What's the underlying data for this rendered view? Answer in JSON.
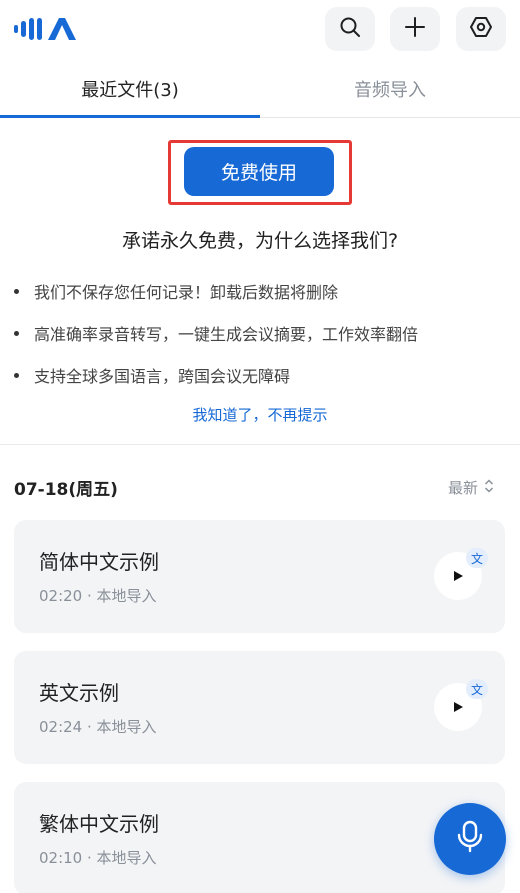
{
  "app": {
    "logo_icon": "mia-logo-icon",
    "accent": "#1769d6"
  },
  "header": {
    "buttons": [
      {
        "icon": "search-icon"
      },
      {
        "icon": "plus-icon"
      },
      {
        "icon": "settings-hex-icon"
      }
    ]
  },
  "tabs": [
    {
      "label": "最近文件(3)",
      "active": true
    },
    {
      "label": "音频导入",
      "active": false
    }
  ],
  "promo": {
    "button_label": "免费使用",
    "title": "承诺永久免费，为什么选择我们?",
    "bullets": [
      "我们不保存您任何记录！卸载后数据将删除",
      "高准确率录音转写，一键生成会议摘要，工作效率翻倍",
      "支持全球多国语言，跨国会议无障碍"
    ],
    "dismiss_label": "我知道了，不再提示"
  },
  "file_list": {
    "date_label": "07-18(周五)",
    "sort_label": "最新",
    "items": [
      {
        "title": "简体中文示例",
        "meta": "02:20 · 本地导入",
        "badge": "文"
      },
      {
        "title": "英文示例",
        "meta": "02:24 · 本地导入",
        "badge": "文"
      },
      {
        "title": "繁体中文示例",
        "meta": "02:10 · 本地导入",
        "badge": ""
      }
    ]
  },
  "fab": {
    "icon": "microphone-icon"
  }
}
